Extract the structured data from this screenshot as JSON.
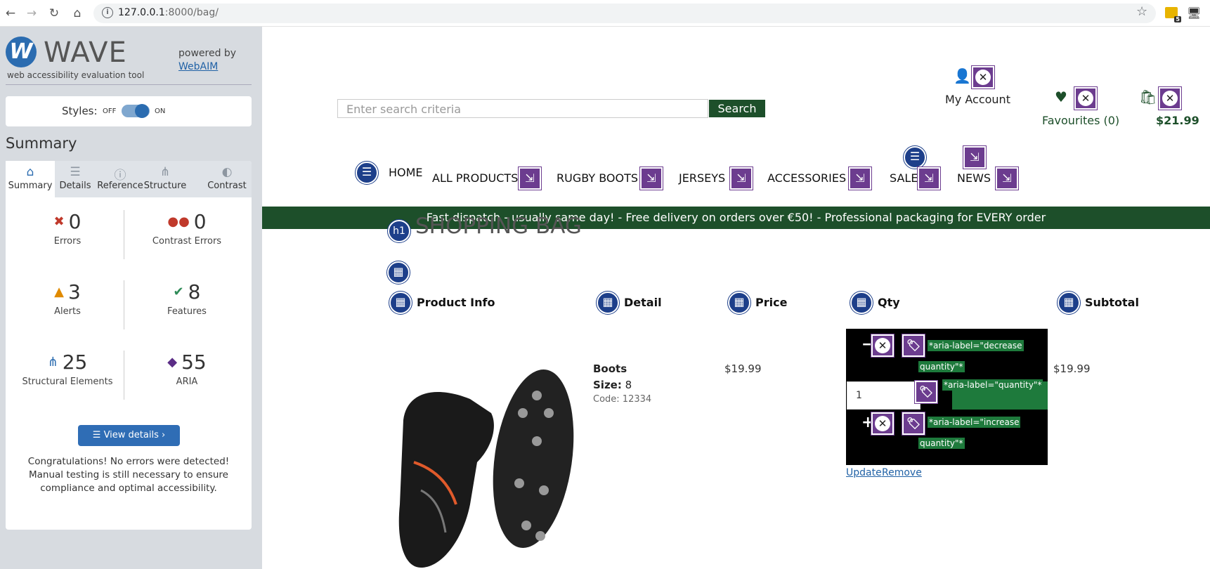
{
  "browser": {
    "url_host": "127.0.0.1",
    "url_path": ":8000/bag/",
    "ext_badge": "5"
  },
  "wave": {
    "logo_letter": "W",
    "title": "WAVE",
    "subtitle": "web accessibility evaluation tool",
    "powered_by": "powered by",
    "webaim_link": "WebAIM",
    "styles_label": "Styles:",
    "styles_off": "OFF",
    "styles_on": "ON",
    "summary_heading": "Summary",
    "tabs": [
      {
        "label": "Summary",
        "icon": "home-icon"
      },
      {
        "label": "Details",
        "icon": "list-icon"
      },
      {
        "label": "Reference",
        "icon": "info-icon"
      },
      {
        "label": "Structure",
        "icon": "structure-icon"
      },
      {
        "label": "Contrast",
        "icon": "contrast-icon"
      }
    ],
    "stats": {
      "errors": {
        "count": "0",
        "label": "Errors"
      },
      "contrast_errors": {
        "count": "0",
        "label": "Contrast Errors"
      },
      "alerts": {
        "count": "3",
        "label": "Alerts"
      },
      "features": {
        "count": "8",
        "label": "Features"
      },
      "structural": {
        "count": "25",
        "label": "Structural Elements"
      },
      "aria": {
        "count": "55",
        "label": "ARIA"
      }
    },
    "view_details": "View details ›",
    "congrats": "Congratulations! No errors were detected! Manual testing is still necessary to ensure compliance and optimal accessibility."
  },
  "site": {
    "search_placeholder": "Enter search criteria",
    "search_button": "Search",
    "my_account": "My Account",
    "favourites": "Favourites (0)",
    "bag_total": "$21.99",
    "nav": [
      "HOME",
      "ALL PRODUCTS",
      "RUGBY BOOTS",
      "JERSEYS",
      "ACCESSORIES",
      "SALE",
      "NEWS"
    ],
    "banner": "Fast dispatch - usually same day! - Free delivery on orders over €50! - Professional packaging for EVERY order",
    "h1_badge": "h1",
    "page_title": "SHOPPING BAG",
    "table_headers": [
      "Product Info",
      "Detail",
      "Price",
      "Qty",
      "Subtotal"
    ],
    "item": {
      "name": "Boots",
      "size_label": "Size:",
      "size_value": "8",
      "code": "Code: 12334",
      "price": "$19.99",
      "subtotal": "$19.99",
      "qty": "1"
    },
    "aria_labels": {
      "decrease_1": "*aria-label=\"decrease",
      "decrease_2": "quantity\"*",
      "quantity": "*aria-label=\"quantity\"*",
      "increase_1": "*aria-label=\"increase",
      "increase_2": "quantity\"*"
    },
    "update_link": "Update",
    "remove_link": "Remove"
  }
}
